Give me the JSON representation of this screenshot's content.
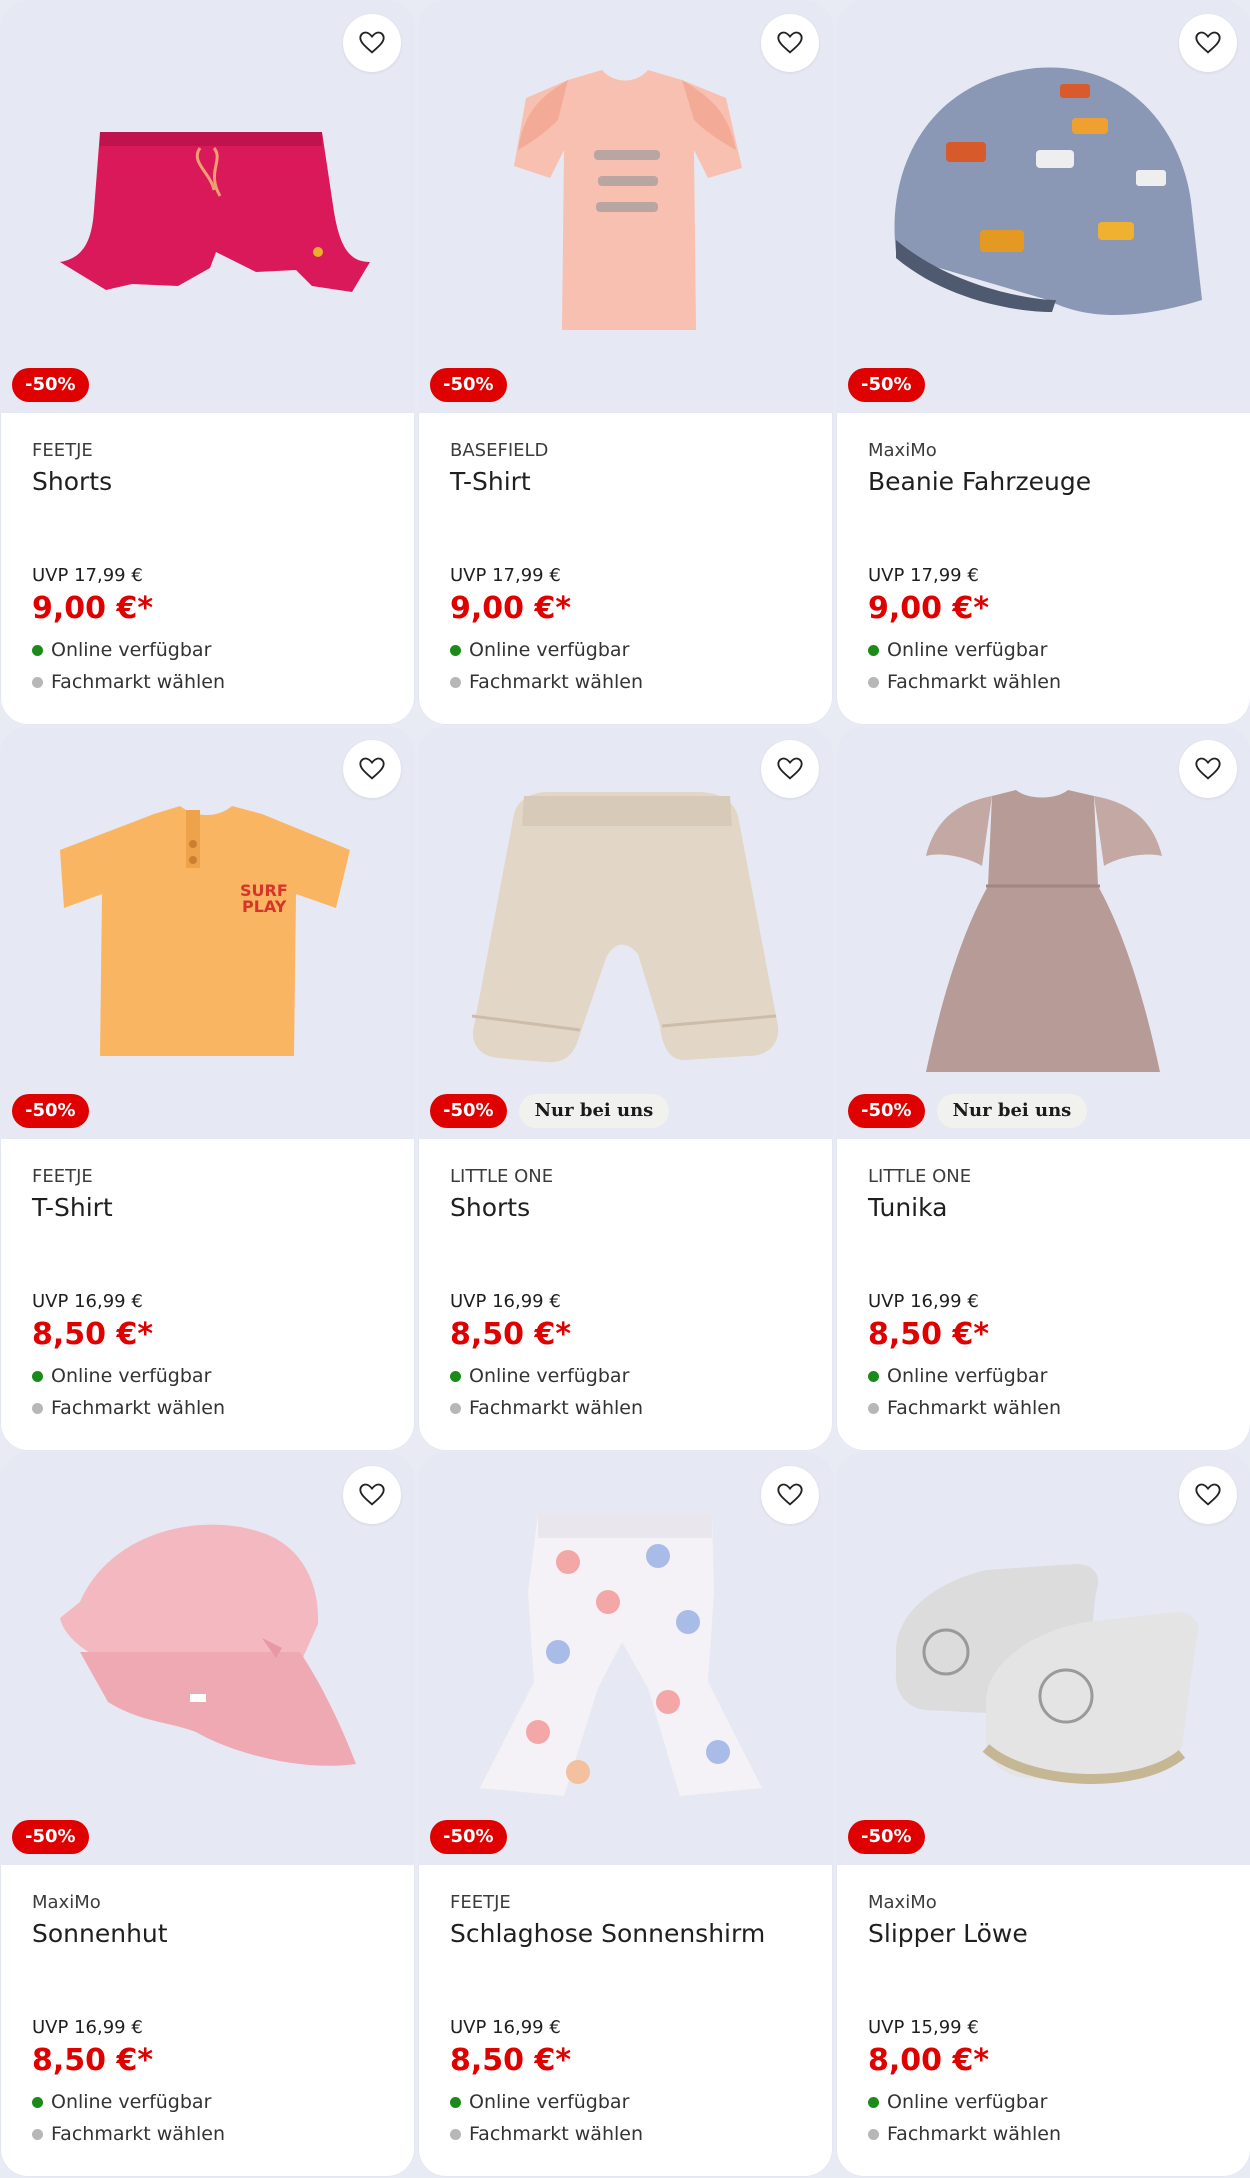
{
  "products": [
    {
      "brand": "FEETJE",
      "title": "Shorts",
      "uvp": "UVP 17,99 €",
      "price": "9,00 €*",
      "discount": "-50%",
      "exclusive": "",
      "online": "Online verfügbar",
      "store": "Fachmarkt wählen",
      "image": "pink-ruffle-shorts"
    },
    {
      "brand": "BASEFIELD",
      "title": "T-Shirt",
      "uvp": "UVP 17,99 €",
      "price": "9,00 €*",
      "discount": "-50%",
      "exclusive": "",
      "online": "Online verfügbar",
      "store": "Fachmarkt wählen",
      "image": "peach-tshirt"
    },
    {
      "brand": "MaxiMo",
      "title": "Beanie Fahrzeuge",
      "uvp": "UVP 17,99 €",
      "price": "9,00 €*",
      "discount": "-50%",
      "exclusive": "",
      "online": "Online verfügbar",
      "store": "Fachmarkt wählen",
      "image": "vehicle-beanie"
    },
    {
      "brand": "FEETJE",
      "title": "T-Shirt",
      "uvp": "UVP 16,99 €",
      "price": "8,50 €*",
      "discount": "-50%",
      "exclusive": "",
      "online": "Online verfügbar",
      "store": "Fachmarkt wählen",
      "image": "orange-tshirt"
    },
    {
      "brand": "LITTLE ONE",
      "title": "Shorts",
      "uvp": "UVP 16,99 €",
      "price": "8,50 €*",
      "discount": "-50%",
      "exclusive": "Nur bei uns",
      "online": "Online verfügbar",
      "store": "Fachmarkt wählen",
      "image": "beige-shorts"
    },
    {
      "brand": "LITTLE ONE",
      "title": "Tunika",
      "uvp": "UVP 16,99 €",
      "price": "8,50 €*",
      "discount": "-50%",
      "exclusive": "Nur bei uns",
      "online": "Online verfügbar",
      "store": "Fachmarkt wählen",
      "image": "mauve-tunic"
    },
    {
      "brand": "MaxiMo",
      "title": "Sonnenhut",
      "uvp": "UVP 16,99 €",
      "price": "8,50 €*",
      "discount": "-50%",
      "exclusive": "",
      "online": "Online verfügbar",
      "store": "Fachmarkt wählen",
      "image": "pink-sun-hat"
    },
    {
      "brand": "FEETJE",
      "title": "Schlaghose Sonnenshirm",
      "uvp": "UVP 16,99 €",
      "price": "8,50 €*",
      "discount": "-50%",
      "exclusive": "",
      "online": "Online verfügbar",
      "store": "Fachmarkt wählen",
      "image": "umbrella-flared-pants"
    },
    {
      "brand": "MaxiMo",
      "title": "Slipper Löwe",
      "uvp": "UVP 15,99 €",
      "price": "8,00 €*",
      "discount": "-50%",
      "exclusive": "",
      "online": "Online verfügbar",
      "store": "Fachmarkt wählen",
      "image": "lion-slippers"
    }
  ],
  "colors": {
    "sale": "#df0000",
    "online": "#1b8a1b",
    "store": "#b7b7b7",
    "image_bg": "#e6e9f3"
  },
  "icons": {
    "wishlist": "heart-outline-icon"
  }
}
